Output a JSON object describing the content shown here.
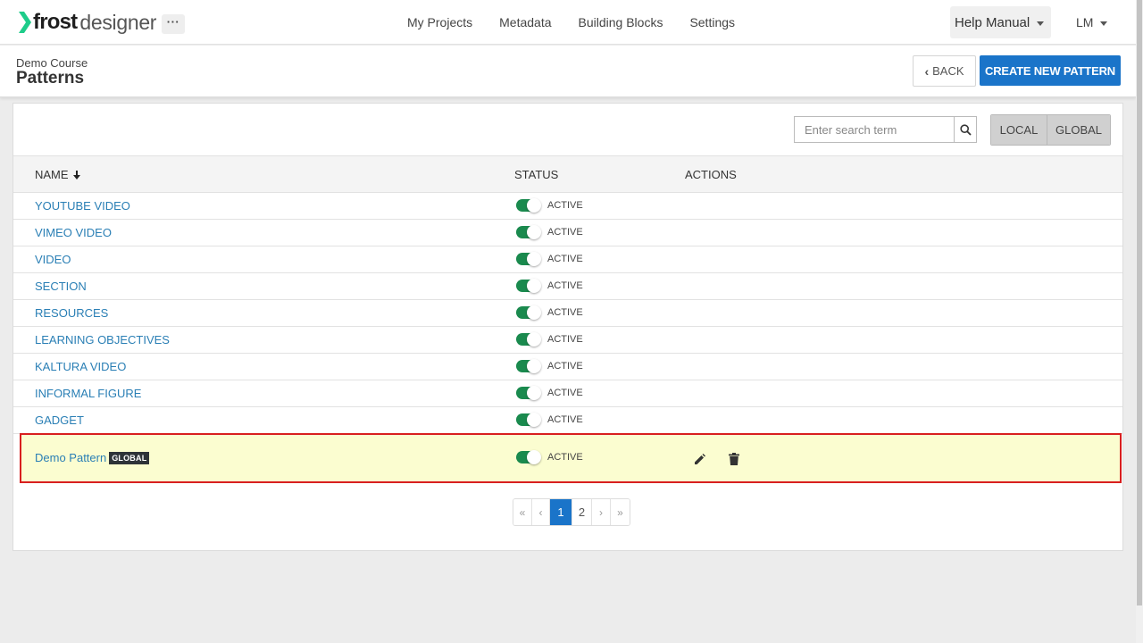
{
  "app": {
    "logo_bold": "frost",
    "logo_light": "designer",
    "more_label": "···"
  },
  "nav": {
    "links": [
      "My Projects",
      "Metadata",
      "Building Blocks",
      "Settings"
    ],
    "help_label": "Help Manual",
    "user_initials": "LM"
  },
  "header": {
    "breadcrumb": "Demo Course",
    "title": "Patterns",
    "back_label": "BACK",
    "create_label": "CREATE NEW PATTERN"
  },
  "toolbar": {
    "search_placeholder": "Enter search term",
    "scope_local": "LOCAL",
    "scope_global": "GLOBAL"
  },
  "table": {
    "columns": {
      "name": "NAME",
      "status": "STATUS",
      "actions": "ACTIONS"
    },
    "rows": [
      {
        "name": "YOUTUBE VIDEO",
        "status": "ACTIVE"
      },
      {
        "name": "VIMEO VIDEO",
        "status": "ACTIVE"
      },
      {
        "name": "VIDEO",
        "status": "ACTIVE"
      },
      {
        "name": "SECTION",
        "status": "ACTIVE"
      },
      {
        "name": "RESOURCES",
        "status": "ACTIVE"
      },
      {
        "name": "LEARNING OBJECTIVES",
        "status": "ACTIVE"
      },
      {
        "name": "KALTURA VIDEO",
        "status": "ACTIVE"
      },
      {
        "name": "INFORMAL FIGURE",
        "status": "ACTIVE"
      },
      {
        "name": "GADGET",
        "status": "ACTIVE"
      }
    ],
    "highlighted_row": {
      "name": "Demo Pattern",
      "badge": "GLOBAL",
      "status": "ACTIVE"
    }
  },
  "pagination": {
    "first": "«",
    "prev": "‹",
    "pages": [
      "1",
      "2"
    ],
    "current": "1",
    "next": "›",
    "last": "»"
  },
  "colors": {
    "accent": "#1a74c9",
    "link": "#2a7fb5",
    "toggle_on": "#1a8a4e",
    "highlight_bg": "#fbfdd0",
    "highlight_border": "#d81f1f",
    "logo_arrow": "#1ecc8a"
  },
  "icons": [
    "logo-arrow-icon",
    "caret-down-icon",
    "chevron-left-icon",
    "search-icon",
    "sort-arrow-down-icon",
    "pencil-icon",
    "trash-icon"
  ]
}
